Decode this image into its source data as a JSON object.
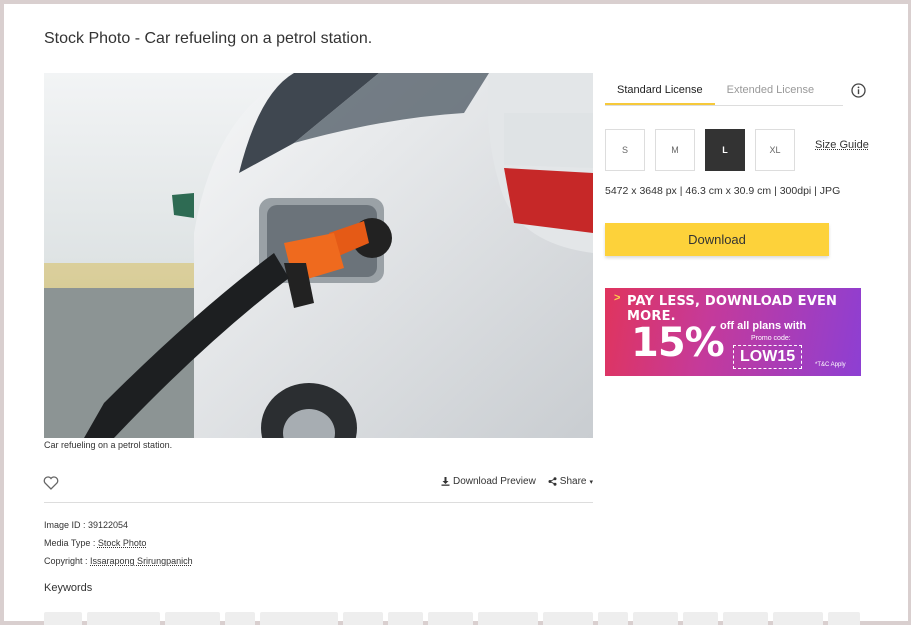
{
  "page": {
    "title": "Stock Photo - Car refueling on a petrol station."
  },
  "image": {
    "caption": "Car refueling on a petrol station.",
    "alt": "white car being refueled with an orange fuel nozzle"
  },
  "actions": {
    "download_preview": "Download Preview",
    "share": "Share"
  },
  "meta": {
    "image_id_label": "Image ID : ",
    "image_id": "39122054",
    "media_type_label": "Media Type : ",
    "media_type": "Stock Photo",
    "copyright_label": "Copyright : ",
    "copyright": "Issarapong Srirungpanich"
  },
  "keywords": {
    "title": "Keywords"
  },
  "license": {
    "tabs": [
      {
        "label": "Standard License",
        "active": true
      },
      {
        "label": "Extended License",
        "active": false
      }
    ]
  },
  "sizes": {
    "options": [
      "S",
      "M",
      "L",
      "XL"
    ],
    "selected": "L",
    "guide_label": "Size Guide"
  },
  "spec": {
    "text": "5472 x 3648 px | 46.3 cm x 30.9 cm | 300dpi | JPG"
  },
  "download": {
    "label": "Download"
  },
  "promo": {
    "headline": "PAY LESS, DOWNLOAD EVEN MORE.",
    "percent": "15%",
    "offer": "off all plans with",
    "promo_code_label": "Promo code:",
    "code": "LOW15",
    "terms": "*T&C Apply"
  },
  "colors": {
    "accent": "#fdd23a",
    "promo_start": "#e0345d",
    "promo_end": "#8d3fd3"
  }
}
